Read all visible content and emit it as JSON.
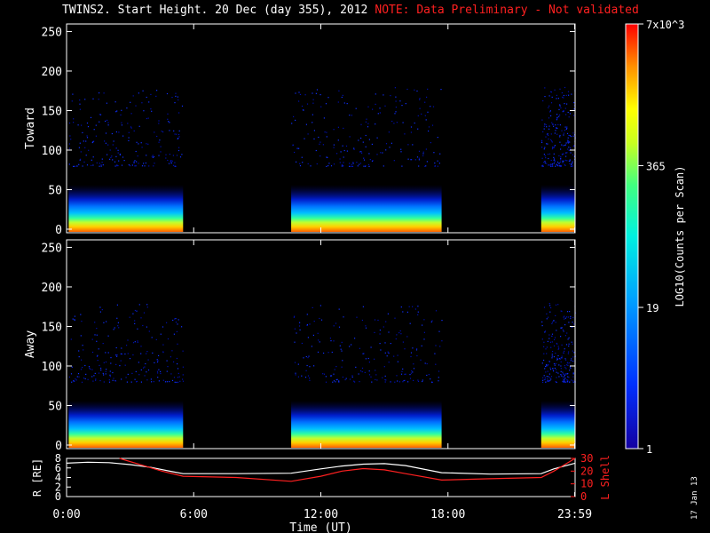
{
  "title": {
    "main": "TWINS2. Start Height. 20 Dec (day 355), 2012",
    "note": "NOTE: Data Preliminary - Not validated"
  },
  "datestamp": "17 Jan 13",
  "colors": {
    "background": "#000000",
    "foreground": "#ffffff",
    "note": "#ff2020",
    "lshell": "#ff2020"
  },
  "chart_data": [
    {
      "type": "heatmap",
      "name": "toward",
      "ylabel": "Toward",
      "ylim": [
        0,
        255
      ],
      "yticks": [
        0,
        50,
        100,
        150,
        200,
        250
      ],
      "xlim_hours": [
        0,
        24
      ],
      "data_intervals_hours": [
        [
          0.1,
          5.5
        ],
        [
          10.6,
          17.7
        ],
        [
          22.4,
          24.0
        ]
      ]
    },
    {
      "type": "heatmap",
      "name": "away",
      "ylabel": "Away",
      "ylim": [
        0,
        255
      ],
      "yticks": [
        0,
        50,
        100,
        150,
        200,
        250
      ],
      "xlim_hours": [
        0,
        24
      ],
      "data_intervals_hours": [
        [
          0.1,
          5.5
        ],
        [
          10.6,
          17.7
        ],
        [
          22.4,
          24.0
        ]
      ]
    },
    {
      "type": "line",
      "name": "orbit",
      "xlim_hours": [
        0,
        24
      ],
      "left_axis": {
        "label": "R [RE]",
        "ylim": [
          0,
          8
        ],
        "ticks": [
          0,
          2,
          4,
          6,
          8
        ]
      },
      "right_axis": {
        "label": "L Shell",
        "ylim": [
          0,
          30
        ],
        "ticks": [
          0,
          10,
          20,
          30
        ]
      },
      "series": [
        {
          "name": "R",
          "axis": "left",
          "color": "#ffffff",
          "x": [
            0,
            1,
            2,
            3,
            4,
            5,
            5.5,
            8,
            10.6,
            12,
            13,
            14,
            15,
            16,
            17.7,
            20,
            22.4,
            23,
            24
          ],
          "y": [
            7.0,
            7.2,
            7.1,
            6.7,
            6.1,
            5.2,
            4.8,
            4.8,
            4.9,
            5.8,
            6.4,
            6.8,
            6.9,
            6.5,
            5.0,
            4.7,
            4.8,
            5.8,
            7.0
          ]
        },
        {
          "name": "L Shell",
          "axis": "right",
          "color": "#ff2020",
          "x": [
            2.5,
            3.5,
            4.5,
            5.5,
            8,
            10.6,
            12,
            13,
            14,
            15,
            16,
            17.7,
            20,
            22.4,
            23,
            24
          ],
          "y": [
            30,
            25,
            20,
            16,
            15,
            12,
            16,
            20,
            22,
            21,
            18,
            13,
            14,
            15,
            20,
            30
          ]
        }
      ]
    }
  ],
  "xaxis": {
    "label": "Time (UT)",
    "ticks": [
      {
        "h": 0,
        "label": "0:00"
      },
      {
        "h": 6,
        "label": "6:00"
      },
      {
        "h": 12,
        "label": "12:00"
      },
      {
        "h": 18,
        "label": "18:00"
      },
      {
        "h": 23.98,
        "label": "23:59"
      }
    ]
  },
  "colorbar": {
    "label": "LOG10(Counts per Scan)",
    "ticks": [
      {
        "value": 1,
        "label": "1"
      },
      {
        "value": 19,
        "label": "19"
      },
      {
        "value": 365,
        "label": "365"
      },
      {
        "value": 7000,
        "label": "7x10^3"
      }
    ],
    "min": 1,
    "max": 7000
  }
}
